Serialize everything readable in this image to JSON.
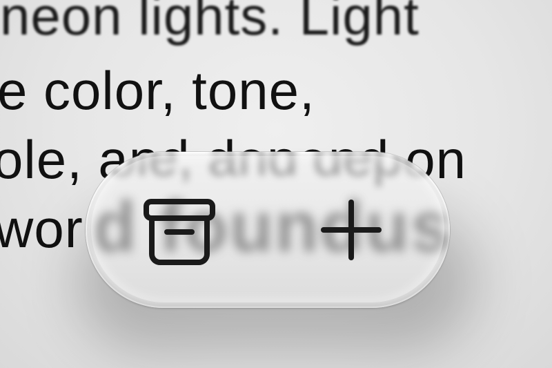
{
  "background_text": {
    "lines": [
      "neon lights. Light",
      "e color, tone,",
      "ole, and depend on",
      "wor"
    ],
    "refracted": "d foundus"
  },
  "toolbar": {
    "actions": [
      {
        "name": "archive",
        "icon": "archive-box-icon"
      },
      {
        "name": "add",
        "icon": "plus-icon"
      }
    ]
  },
  "colors": {
    "icon": "#1a1a1a",
    "text": "#111111",
    "pill": "#e9e9e9",
    "background": "#e6e6e6"
  }
}
